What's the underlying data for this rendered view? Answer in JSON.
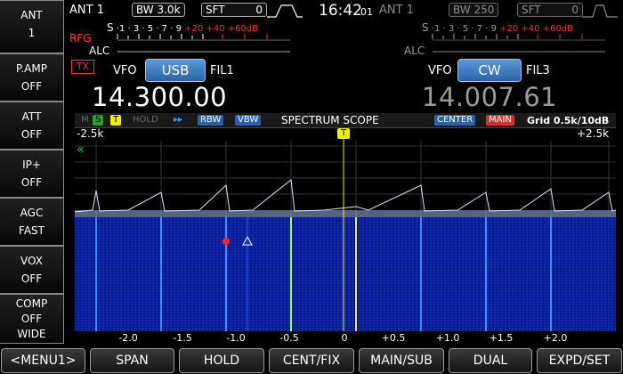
{
  "sidebar": {
    "items": [
      {
        "label": "ANT",
        "value": "1"
      },
      {
        "label": "P.AMP",
        "value": "OFF"
      },
      {
        "label": "ATT",
        "value": "OFF"
      },
      {
        "label": "IP+",
        "value": "OFF"
      },
      {
        "label": "AGC",
        "value": "FAST"
      },
      {
        "label": "VOX",
        "value": "OFF"
      },
      {
        "label": "COMP",
        "value": "OFF",
        "extra": "WIDE"
      }
    ]
  },
  "main_rx": {
    "antenna": "ANT 1",
    "bw": "BW 3.0k",
    "sft_label": "SFT",
    "sft_value": "0",
    "rfg_label": "RFG",
    "alc_label": "ALC",
    "s_label": "S",
    "s_scale": "·1 · 3 · 5 · 7 · 9",
    "s_over": "+20 +40 +60dB",
    "tx_label": "TX",
    "vfo_label": "VFO",
    "mode": "USB",
    "filter": "FIL1",
    "frequency": "14.300.00"
  },
  "clock": {
    "time": "16:42",
    "seconds": "01"
  },
  "sub_rx": {
    "antenna": "ANT 1",
    "bw": "BW 250",
    "sft_label": "SFT",
    "sft_value": "0",
    "alc_label": "ALC",
    "s_label": "S",
    "s_scale": "·1 · 3 · 5 · 7 · 9",
    "s_over": "+20 +40 +60dB",
    "vfo_label": "VFO",
    "mode": "CW",
    "filter": "FIL3",
    "frequency": "14.007.61"
  },
  "scope": {
    "title": "SPECTRUM SCOPE",
    "tags": {
      "m": "M",
      "s": "S",
      "t": "T",
      "hold": "HOLD",
      "arrows": "▸▸",
      "rbw": "RBW",
      "vbw": "VBW"
    },
    "mode": "CENTER",
    "target": "MAIN",
    "grid": "Grid 0.5k/10dB",
    "span_left": "-2.5k",
    "span_right": "+2.5k",
    "marker": "T",
    "arrow_left": "«",
    "x_ticks": [
      "-2.0",
      "-1.5",
      "-1.0",
      "-0.5",
      "0",
      "+0.5",
      "+1.0",
      "+1.5",
      "+2.0"
    ],
    "colors": {
      "waterfall": "#0a1e9a",
      "spectrum": "#cfe4ff",
      "marker": "#f0f000"
    }
  },
  "menu": {
    "buttons": [
      "<MENU1>",
      "SPAN",
      "HOLD",
      "CENT/FIX",
      "MAIN/SUB",
      "DUAL",
      "EXPD/SET"
    ]
  }
}
